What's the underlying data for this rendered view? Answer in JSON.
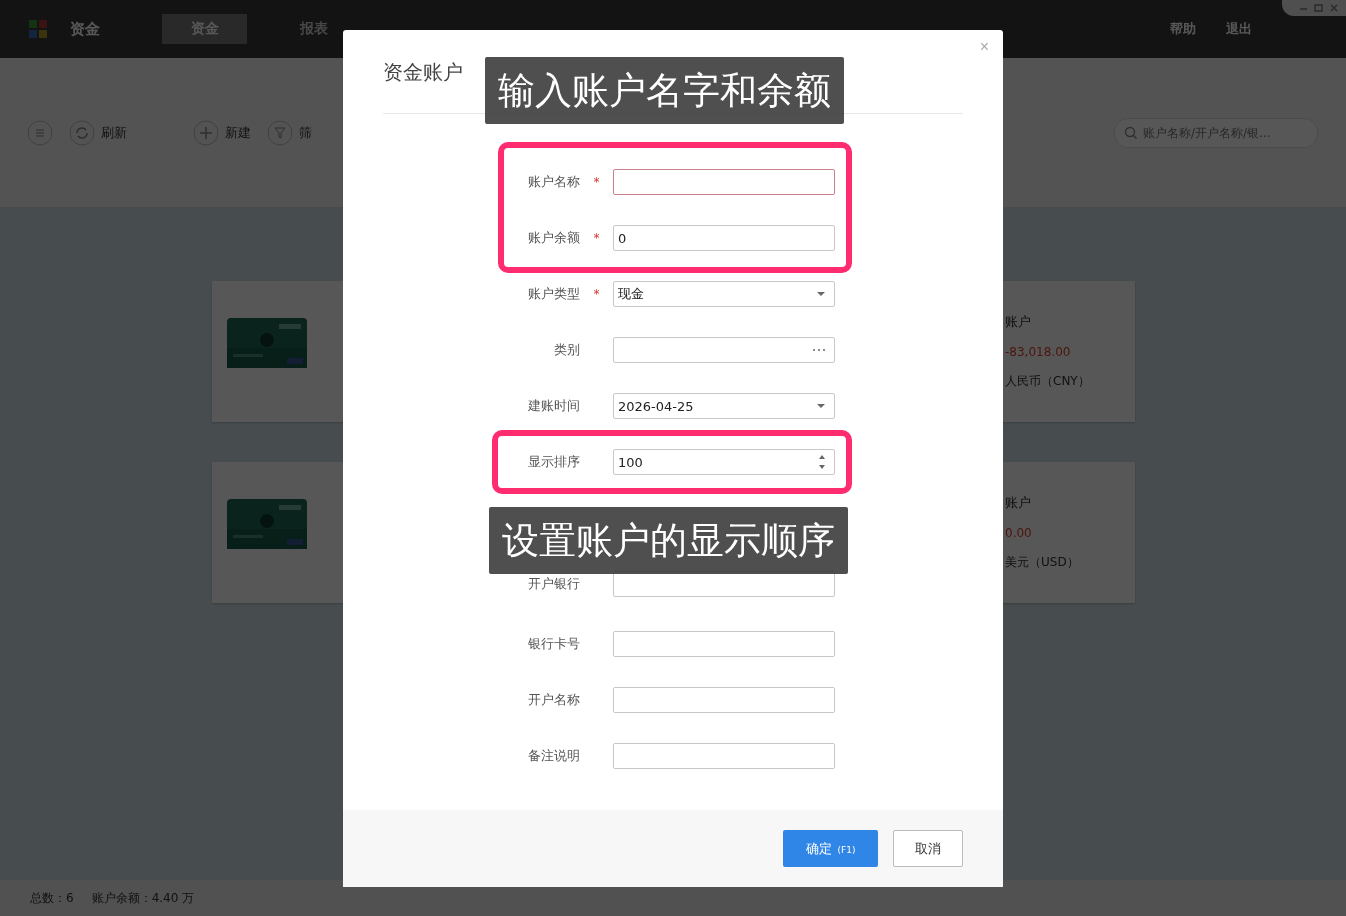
{
  "app": {
    "logo_text": "资金",
    "nav": [
      {
        "label": "资金",
        "selected": true
      },
      {
        "label": "报表",
        "selected": false
      }
    ],
    "user_links": [
      "帮助",
      "退出"
    ]
  },
  "toolbar": {
    "refresh": "刷新",
    "new": "新建",
    "filter": "筛",
    "search": {
      "placeholder": "账户名称/开户名称/银..."
    }
  },
  "cards": [
    {
      "kind": "left"
    },
    {
      "kind": "right",
      "title": "账户",
      "amount": "-83,018.00",
      "currency": "人民币（CNY）"
    },
    {
      "kind": "left"
    },
    {
      "kind": "right",
      "title": "账户",
      "amount": "0.00",
      "currency": "美元（USD）"
    }
  ],
  "status_bar": {
    "count": "总数：6",
    "balance": "账户余额：4.40 万"
  },
  "dialog": {
    "title": "资金账户",
    "close": "×",
    "required_mark": "*",
    "fields": [
      {
        "label": "账户名称",
        "required": true,
        "kind": "text",
        "invalid": true
      },
      {
        "label": "账户余额",
        "required": true,
        "kind": "text",
        "value": "0",
        "invalid": false
      },
      {
        "label": "账户类型",
        "required": true,
        "kind": "select",
        "value": "现金",
        "invalid": false
      },
      {
        "label": "类别",
        "required": false,
        "kind": "picker",
        "invalid": false
      },
      {
        "label": "建账时间",
        "required": false,
        "kind": "select",
        "value": "2026-04-25",
        "invalid": false
      },
      {
        "label": "显示排序",
        "required": false,
        "kind": "number",
        "value": "100",
        "invalid": false
      },
      {
        "label": "开户银行",
        "required": false,
        "kind": "text",
        "invalid": false
      },
      {
        "label": "银行卡号",
        "required": false,
        "kind": "text",
        "invalid": false
      },
      {
        "label": "开户名称",
        "required": false,
        "kind": "text",
        "invalid": false
      },
      {
        "label": "备注说明",
        "required": false,
        "kind": "text",
        "invalid": false
      }
    ],
    "ok": {
      "label": "确定",
      "shortcut": "(F1)"
    },
    "cancel": "取消"
  },
  "annotations": [
    {
      "text": "输入账户名字和余额"
    },
    {
      "text": "设置账户的显示顺序"
    }
  ]
}
